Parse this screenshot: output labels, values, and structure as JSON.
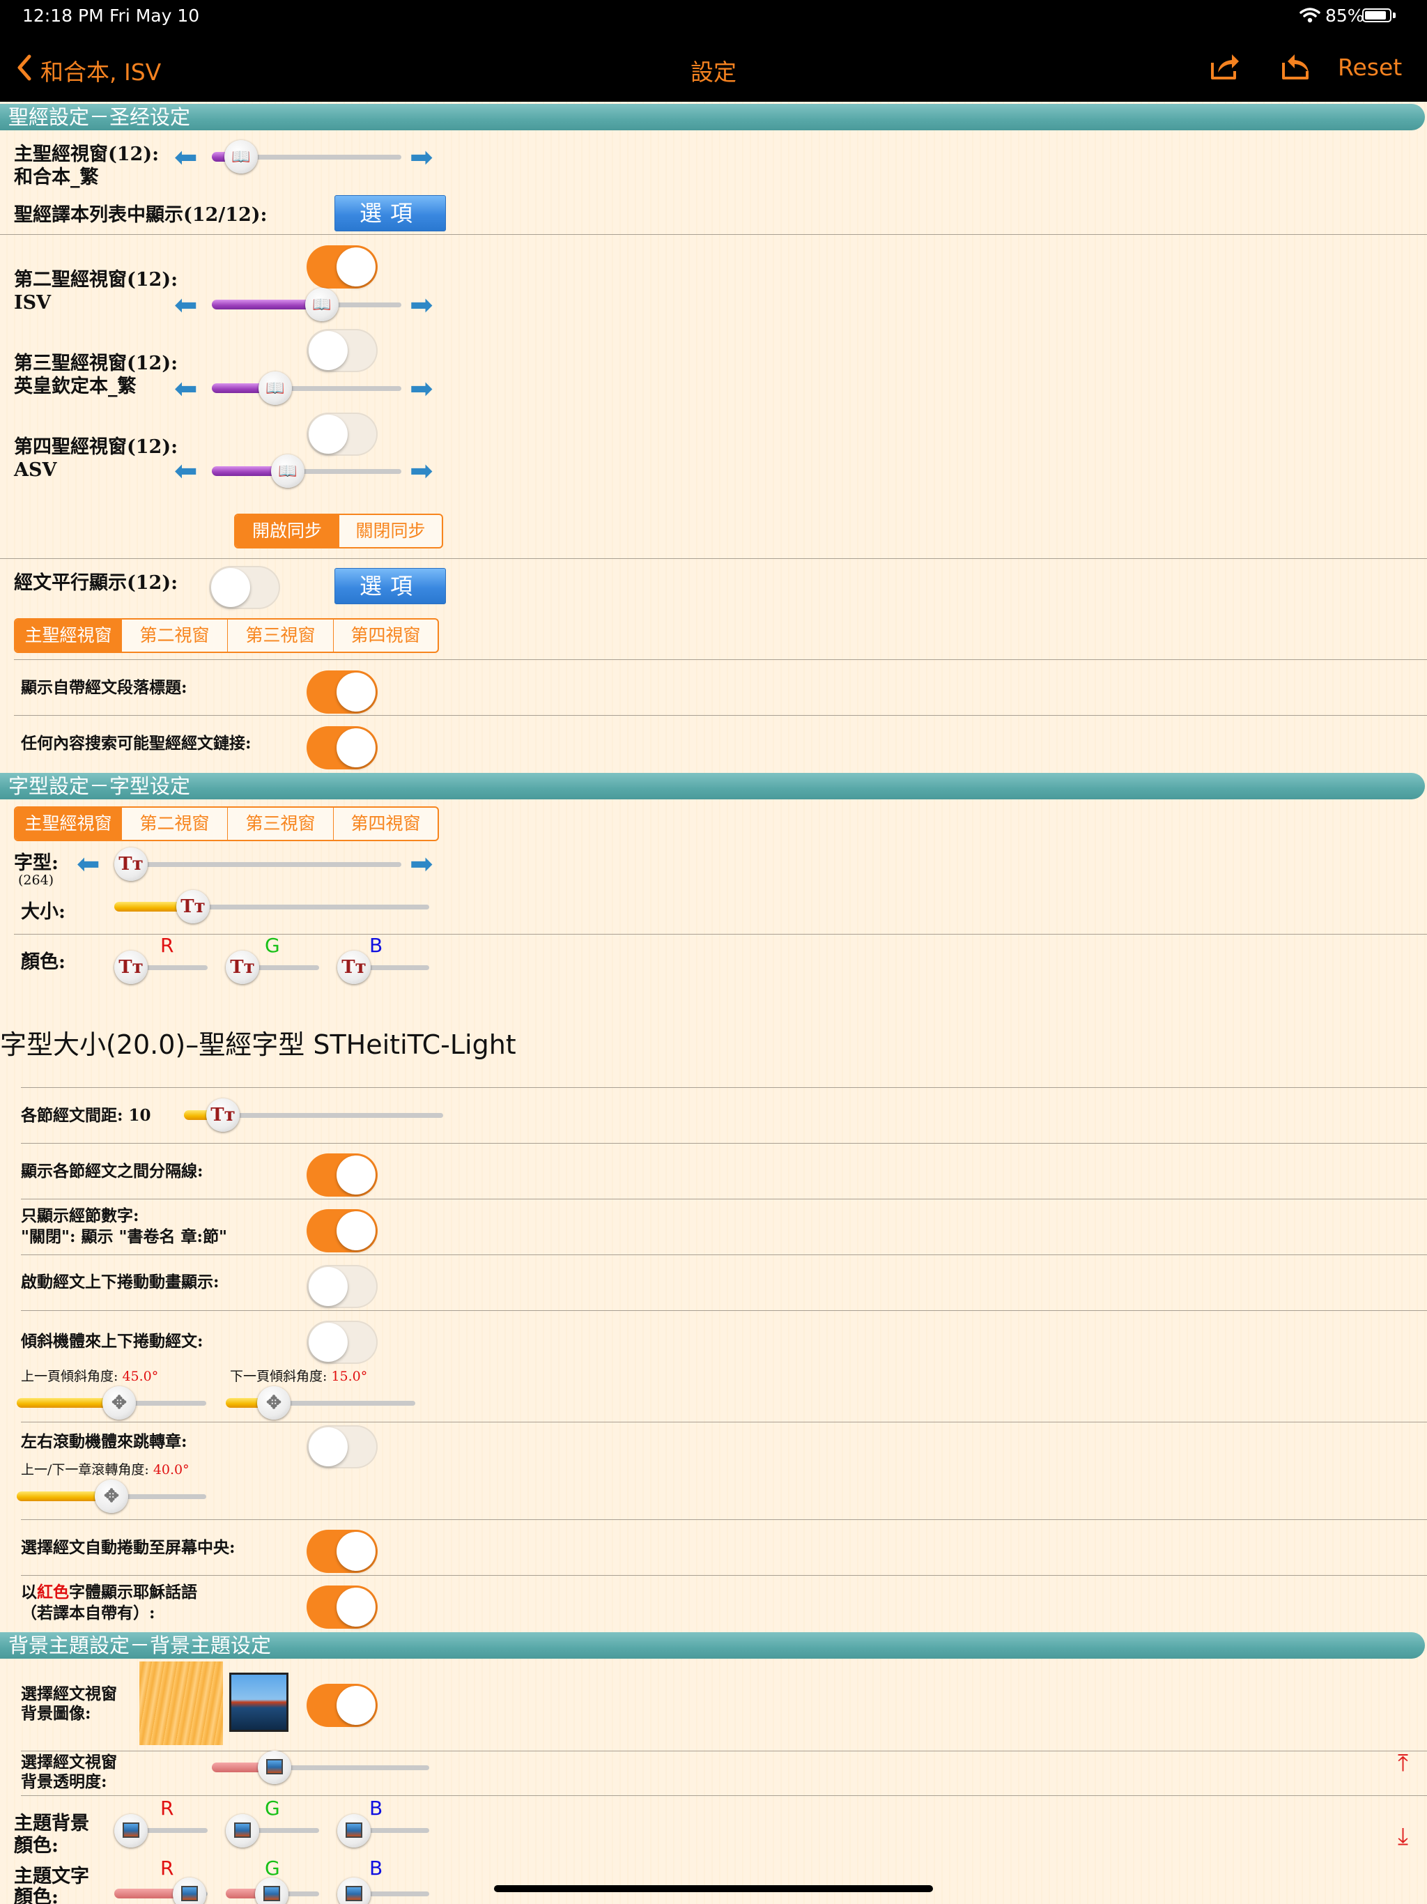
{
  "status_bar": {
    "time": "12:18 PM",
    "date": "Fri May 10",
    "battery": "85%"
  },
  "nav": {
    "back_label": "和合本, ISV",
    "title": "設定",
    "reset": "Reset"
  },
  "sections": {
    "bible": "聖經設定－圣经设定",
    "font": "字型設定－字型设定",
    "theme": "背景主題設定－背景主題设定"
  },
  "bible_settings": {
    "main_window": {
      "label": "主聖經視窗(12):",
      "version": "和合本_繁"
    },
    "version_list_label": "聖經譯本列表中顯示(12/12):",
    "options_label": "選項",
    "second_window": {
      "label": "第二聖經視窗(12):",
      "version": "ISV"
    },
    "third_window": {
      "label": "第三聖經視窗(12):",
      "version": "英皇欽定本_繁"
    },
    "fourth_window": {
      "label": "第四聖經視窗(12):",
      "version": "ASV"
    },
    "sync_on": "開啟同步",
    "sync_off": "關閉同步",
    "parallel_label": "經文平行顯示(12):",
    "window_tabs": [
      "主聖經視窗",
      "第二視窗",
      "第三視窗",
      "第四視窗"
    ],
    "show_headings": "顯示自帶經文段落標題:",
    "search_links": "任何內容搜索可能聖經經文鏈接:"
  },
  "font_settings": {
    "window_tabs": [
      "主聖經視窗",
      "第二視窗",
      "第三視窗",
      "第四視窗"
    ],
    "font_label": "字型:",
    "font_count": "(264)",
    "size_label": "大小:",
    "color_label": "顏色:",
    "r": "R",
    "g": "G",
    "b": "B",
    "sample": "字型大小(20.0)–聖經字型 STHeitiTC-Light",
    "verse_spacing": "各節經文間距: 10",
    "show_separator": "顯示各節經文之間分隔線:",
    "verse_num_only_1": "只顯示經節數字:",
    "verse_num_only_2": "\"關閉\": 顯示 \"書卷名 章:節\"",
    "scroll_animation": "啟動經文上下捲動動畫顯示:",
    "tilt_scroll": "傾斜機體來上下捲動經文:",
    "prev_tilt_label": "上一頁傾斜角度: ",
    "prev_tilt_value": "45.0°",
    "next_tilt_label": "下一頁傾斜角度: ",
    "next_tilt_value": "15.0°",
    "roll_chapter": "左右滾動機體來跳轉章:",
    "roll_angle_label": "上一/下一章滾轉角度: ",
    "roll_angle_value": "40.0°",
    "auto_center": "選擇經文自動捲動至屏幕中央:",
    "red_letter_pre": "以",
    "red_letter_red": "紅色",
    "red_letter_post": "字體顯示耶穌話語",
    "red_letter_note": "（若譯本自帶有）:"
  },
  "theme_settings": {
    "bg_image_1": "選擇經文視窗",
    "bg_image_2": "背景圖像:",
    "bg_alpha_1": "選擇經文視窗",
    "bg_alpha_2": "背景透明度:",
    "theme_bg_1": "主題背景",
    "theme_bg_2": "顏色:",
    "theme_text_1": "主題文字",
    "theme_text_2": "顏色:",
    "r": "R",
    "g": "G",
    "b": "B"
  },
  "slider_levels": {
    "main_window": 0.08,
    "second_window": 0.6,
    "third_window": 0.3,
    "fourth_window": 0.38,
    "font_face": 0.0,
    "font_size": 0.22,
    "verse_spacing": 0.1,
    "prev_tilt": 0.55,
    "next_tilt": 0.2,
    "roll_angle": 0.5,
    "bg_alpha": 0.25
  },
  "colors": {
    "accent": "#f7851e",
    "section": "#58a8a8",
    "option_button": "#3a88e0",
    "red_letter": "#e01010"
  },
  "icons": [
    "chevron-left-icon",
    "wifi-icon",
    "battery-icon",
    "share-icon",
    "import-icon",
    "arrow-left-icon",
    "arrow-right-icon",
    "book-icon",
    "font-icon",
    "tilt-icon",
    "photo-icon",
    "scroll-top-icon",
    "scroll-bottom-icon"
  ]
}
